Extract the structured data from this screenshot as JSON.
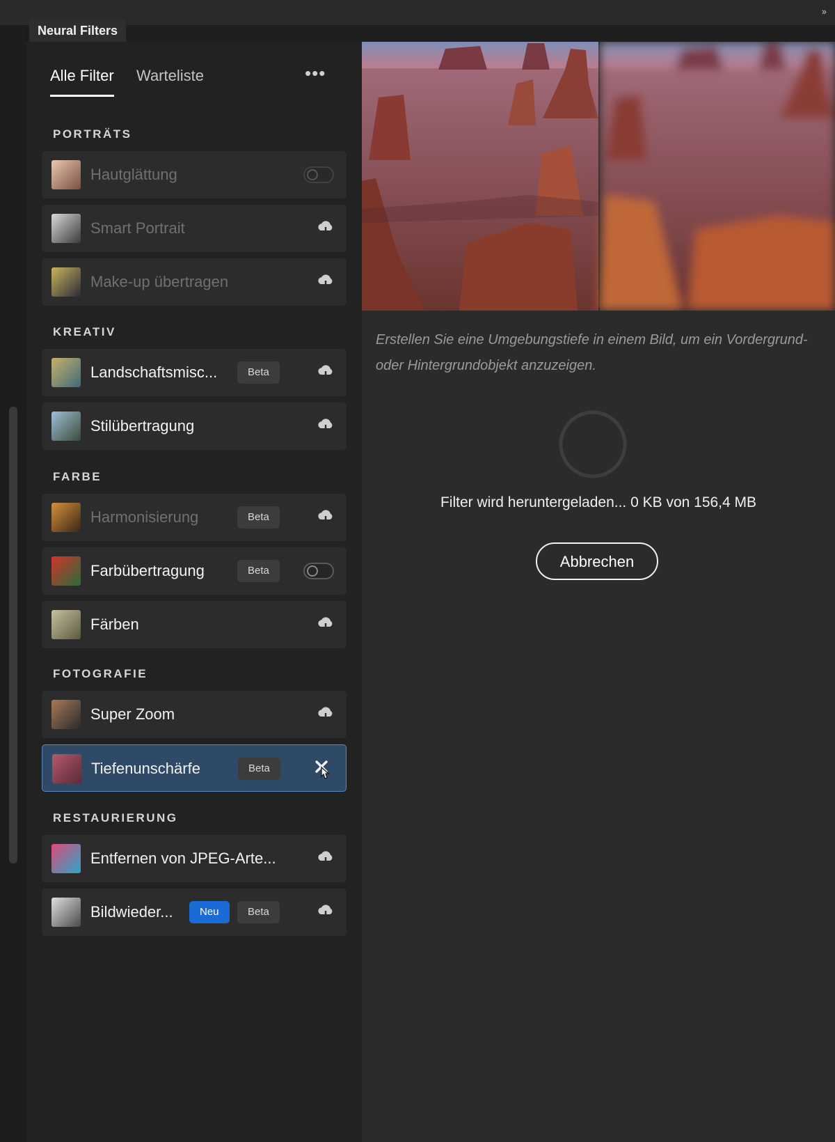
{
  "panel": {
    "title": "Neural Filters"
  },
  "tabs": [
    {
      "label": "Alle Filter",
      "active": true
    },
    {
      "label": "Warteliste",
      "active": false
    }
  ],
  "sections": [
    {
      "title": "PORTRÄTS",
      "items": [
        {
          "label": "Hautglättung",
          "state": "toggle-off",
          "disabled": true,
          "thumb_colors": [
            "#e9c8b2",
            "#7a5040"
          ]
        },
        {
          "label": "Smart Portrait",
          "state": "download",
          "disabled": true,
          "thumb_colors": [
            "#d9d9d9",
            "#3a3a3a"
          ]
        },
        {
          "label": "Make-up übertragen",
          "state": "download",
          "disabled": true,
          "thumb_colors": [
            "#c9b45a",
            "#2b2b3a"
          ]
        }
      ]
    },
    {
      "title": "KREATIV",
      "items": [
        {
          "label": "Landschaftsmisc...",
          "badge": "Beta",
          "state": "download",
          "thumb_colors": [
            "#c9b06a",
            "#3f6a7a"
          ]
        },
        {
          "label": "Stilübertragung",
          "state": "download",
          "thumb_colors": [
            "#9ec0d8",
            "#3b4a3a"
          ]
        }
      ]
    },
    {
      "title": "FARBE",
      "items": [
        {
          "label": "Harmonisierung",
          "badge": "Beta",
          "state": "download",
          "disabled": true,
          "thumb_colors": [
            "#d5923a",
            "#3a2418"
          ]
        },
        {
          "label": "Farbübertragung",
          "badge": "Beta",
          "state": "toggle-off",
          "thumb_colors": [
            "#d0362a",
            "#2a6a3a"
          ]
        },
        {
          "label": "Färben",
          "state": "download",
          "thumb_colors": [
            "#c7c0a0",
            "#5a5a40"
          ]
        }
      ]
    },
    {
      "title": "FOTOGRAFIE",
      "items": [
        {
          "label": "Super Zoom",
          "state": "download",
          "thumb_colors": [
            "#a87a5a",
            "#2a2a2a"
          ]
        },
        {
          "label": "Tiefenunschärfe",
          "badge": "Beta",
          "state": "cancel",
          "selected": true,
          "thumb_colors": [
            "#b55a6a",
            "#5a2a3a"
          ]
        }
      ]
    },
    {
      "title": "RESTAURIERUNG",
      "items": [
        {
          "label": "Entfernen von JPEG-Arte...",
          "state": "download",
          "thumb_colors": [
            "#e04a7a",
            "#2aa6c8"
          ]
        },
        {
          "label": "Bildwieder...",
          "badges": [
            "Neu",
            "Beta"
          ],
          "state": "download",
          "thumb_colors": [
            "#e0e0e0",
            "#4a4a4a"
          ]
        }
      ]
    }
  ],
  "detail": {
    "description": "Erstellen Sie eine Umgebungstiefe in einem Bild, um ein Vordergrund- oder Hintergrundobjekt anzuzeigen.",
    "status": "Filter wird heruntergeladen... 0 KB von 156,4 MB",
    "cancel_label": "Abbrechen"
  },
  "colors": {
    "selected_bg": "#2f4a66",
    "new_badge": "#1a6bd6",
    "panel_bg": "#222222"
  }
}
